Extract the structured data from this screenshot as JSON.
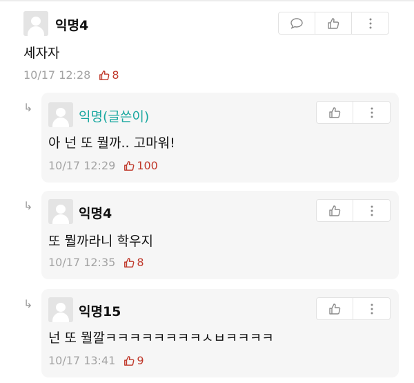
{
  "comments": [
    {
      "name": "익명4",
      "text": "세자자",
      "time": "10/17 12:28",
      "likes": "8",
      "buttons": [
        "comment-icon",
        "thumbs-up-icon",
        "more-vert-icon"
      ]
    }
  ],
  "replies": [
    {
      "name": "익명(글쓴이)",
      "text": "아 넌 또 뭘까.. 고마워!",
      "time": "10/17 12:29",
      "likes": "100",
      "is_author": true
    },
    {
      "name": "익명4",
      "text": "또 뭘까라니 학우지",
      "time": "10/17 12:35",
      "likes": "8"
    },
    {
      "name": "익명15",
      "text": "넌 또 뭘깔ㅋㅋㅋㅋㅋㅋㅋㅋㅅㅂㅋㅋㅋㅋ",
      "time": "10/17 13:41",
      "likes": "9"
    }
  ],
  "colors": {
    "author_name": "#1aa8a0",
    "like": "#c0392b",
    "meta": "#a3a3a3",
    "reply_bg": "#f6f6f6"
  }
}
